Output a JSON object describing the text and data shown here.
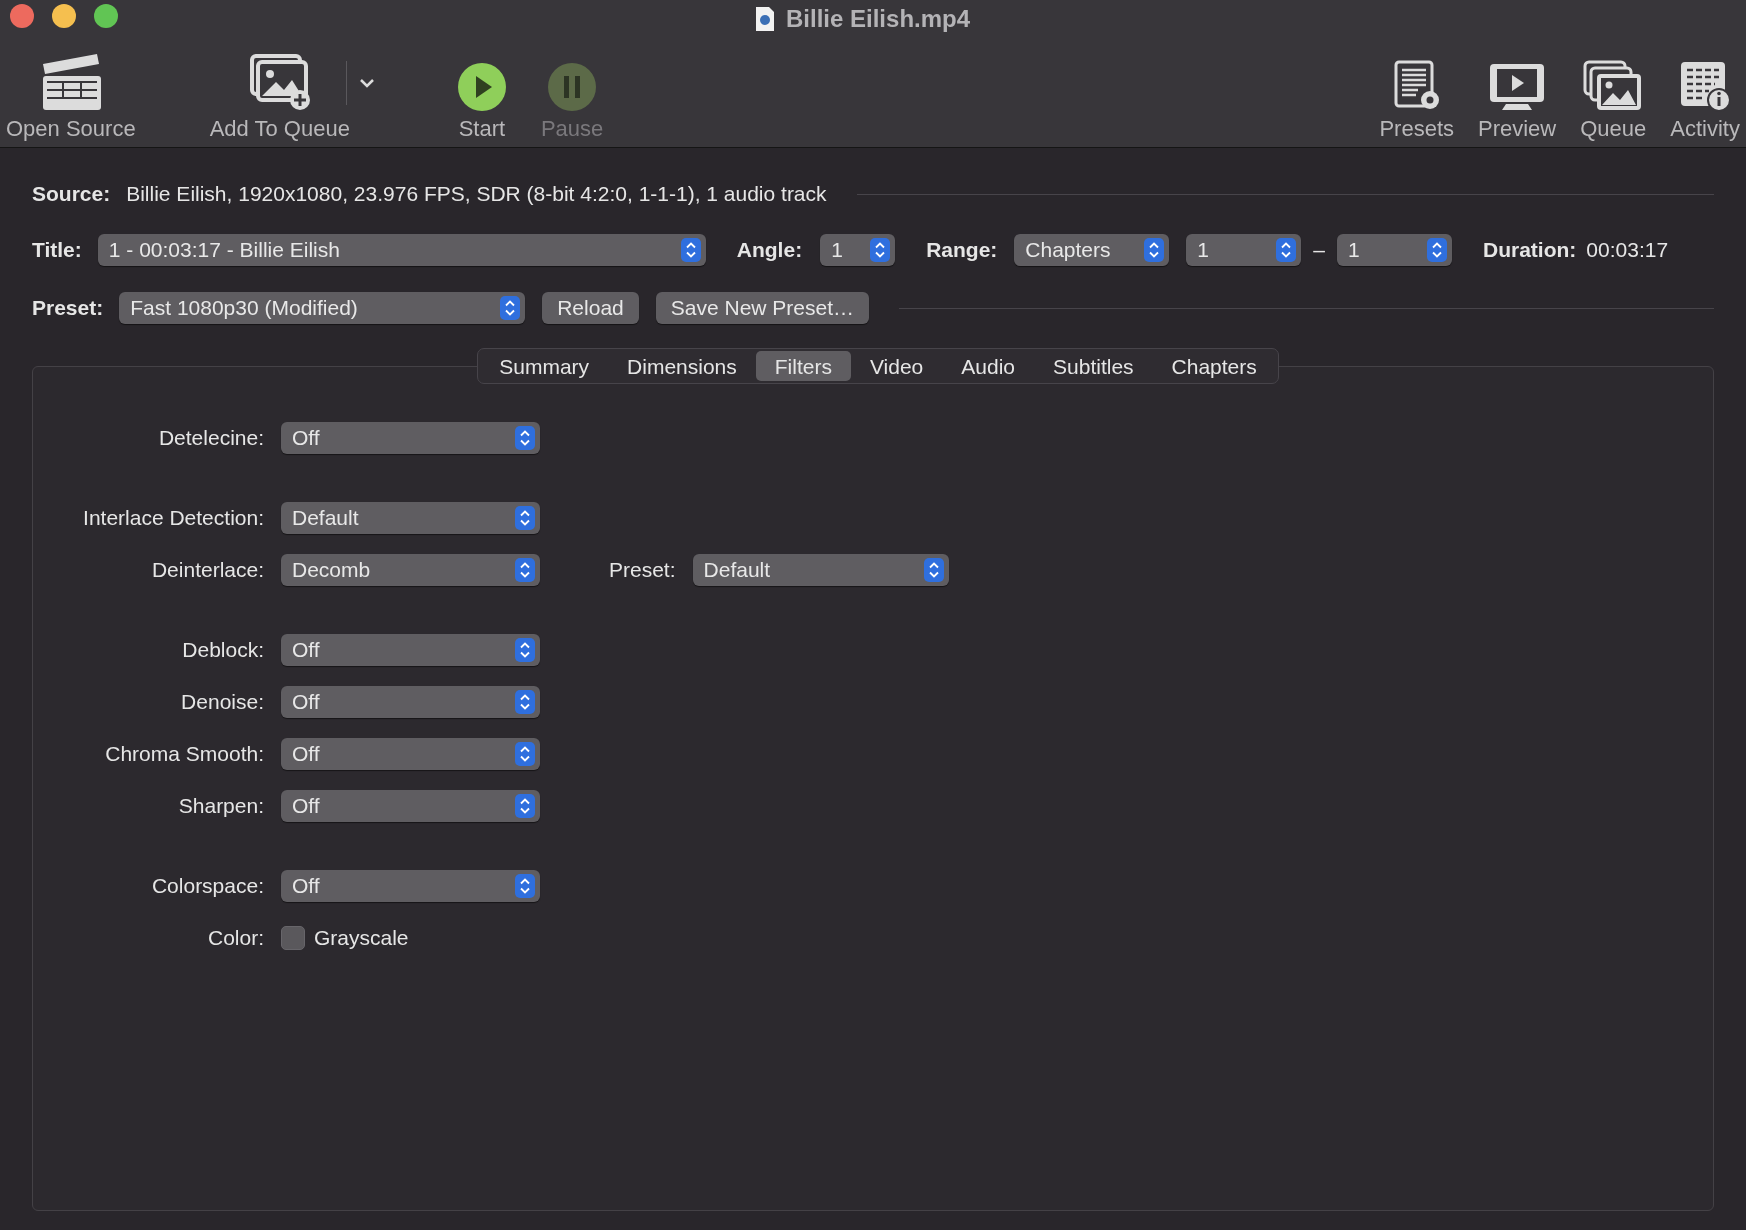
{
  "window": {
    "title": "Billie Eilish.mp4"
  },
  "toolbar": {
    "left": [
      {
        "label": "Open Source",
        "disabled": false
      },
      {
        "label": "Add To Queue",
        "disabled": false
      },
      {
        "label": "Start",
        "disabled": false
      },
      {
        "label": "Pause",
        "disabled": true
      }
    ],
    "right": [
      {
        "label": "Presets",
        "disabled": false
      },
      {
        "label": "Preview",
        "disabled": false
      },
      {
        "label": "Queue",
        "disabled": false
      },
      {
        "label": "Activity",
        "disabled": false
      }
    ]
  },
  "source": {
    "label": "Source:",
    "value": "Billie Eilish, 1920x1080, 23.976 FPS, SDR (8-bit 4:2:0, 1-1-1), 1 audio track"
  },
  "title_row": {
    "title_label": "Title:",
    "title_value": "1 - 00:03:17 - Billie Eilish",
    "angle_label": "Angle:",
    "angle_value": "1",
    "range_label": "Range:",
    "range_value": "Chapters",
    "range_start": "1",
    "range_separator": "–",
    "range_end": "1",
    "duration_label": "Duration:",
    "duration_value": "00:03:17"
  },
  "preset_row": {
    "label": "Preset:",
    "value": "Fast 1080p30 (Modified)",
    "buttons": [
      "Reload",
      "Save New Preset…"
    ]
  },
  "tabs": [
    {
      "label": "Summary",
      "selected": false
    },
    {
      "label": "Dimensions",
      "selected": false
    },
    {
      "label": "Filters",
      "selected": true
    },
    {
      "label": "Video",
      "selected": false
    },
    {
      "label": "Audio",
      "selected": false
    },
    {
      "label": "Subtitles",
      "selected": false
    },
    {
      "label": "Chapters",
      "selected": false
    }
  ],
  "filters": [
    [
      {
        "kind": "popup",
        "label": "Detelecine:",
        "value": "Off"
      }
    ],
    [
      {
        "kind": "popup",
        "label": "Interlace Detection:",
        "value": "Default"
      },
      {
        "kind": "popup",
        "label": "Deinterlace:",
        "value": "Decomb",
        "extra_label": "Preset:",
        "extra_value": "Default"
      }
    ],
    [
      {
        "kind": "popup",
        "label": "Deblock:",
        "value": "Off"
      },
      {
        "kind": "popup",
        "label": "Denoise:",
        "value": "Off"
      },
      {
        "kind": "popup",
        "label": "Chroma Smooth:",
        "value": "Off"
      },
      {
        "kind": "popup",
        "label": "Sharpen:",
        "value": "Off"
      }
    ],
    [
      {
        "kind": "popup",
        "label": "Colorspace:",
        "value": "Off"
      },
      {
        "kind": "checkbox",
        "label": "Color:",
        "value": "Grayscale",
        "checked": false
      }
    ]
  ]
}
